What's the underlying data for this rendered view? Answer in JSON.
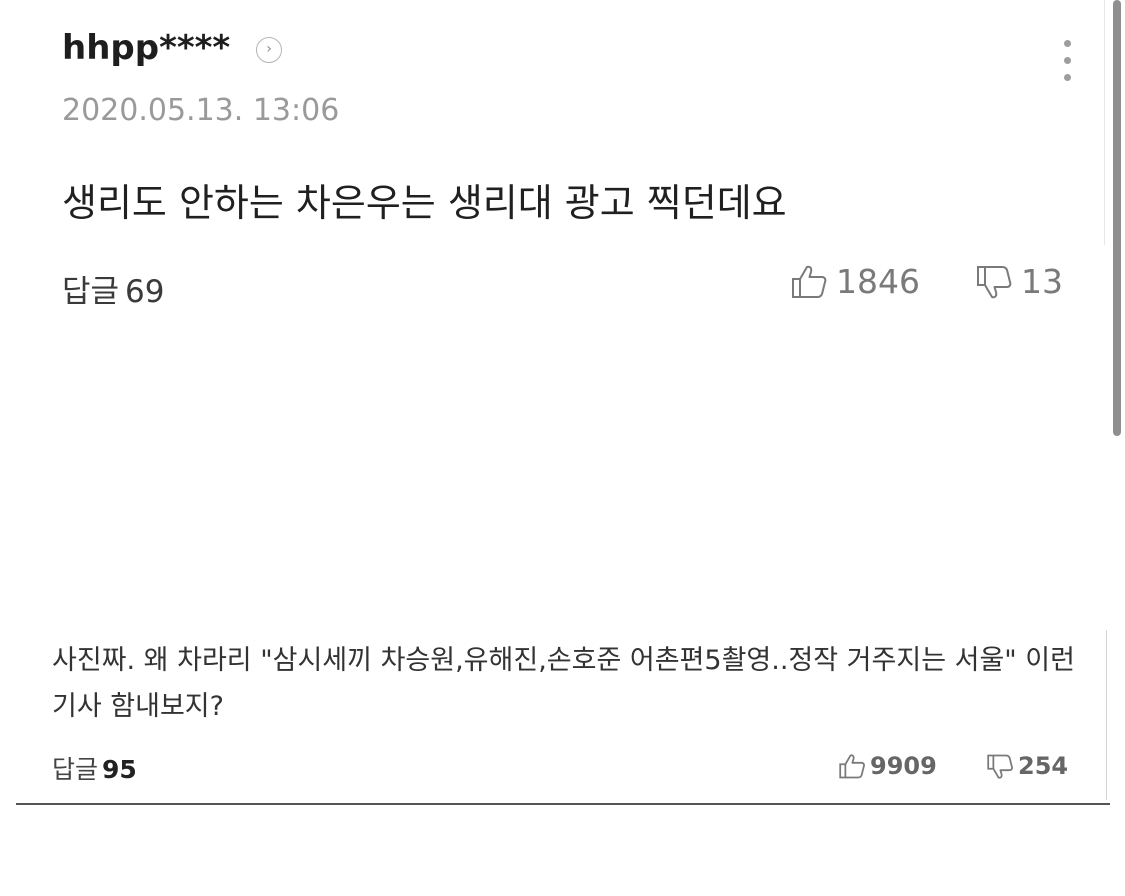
{
  "comments": [
    {
      "username": "hhpp****",
      "profile_icon": "chevron-right-circle-icon",
      "timestamp": "2020.05.13. 13:06",
      "text": "생리도 안하는 차은우는 생리대 광고 찍던데요",
      "reply_label": "답글",
      "reply_count": "69",
      "likes": "1846",
      "dislikes": "13",
      "menu_icon": "more-vertical-icon"
    },
    {
      "text": "사진짜. 왜 차라리 \"삼시세끼 차승원,유해진,손호준 어촌편5촬영..정작 거주지는 서울\" 이런기사 함내보지?",
      "reply_label": "답글",
      "reply_count": "95",
      "likes": "9909",
      "dislikes": "254"
    }
  ],
  "colors": {
    "text_primary": "#222222",
    "text_muted": "#9a9a9a",
    "icon_gray": "#7a7a7a",
    "divider": "#555555"
  }
}
